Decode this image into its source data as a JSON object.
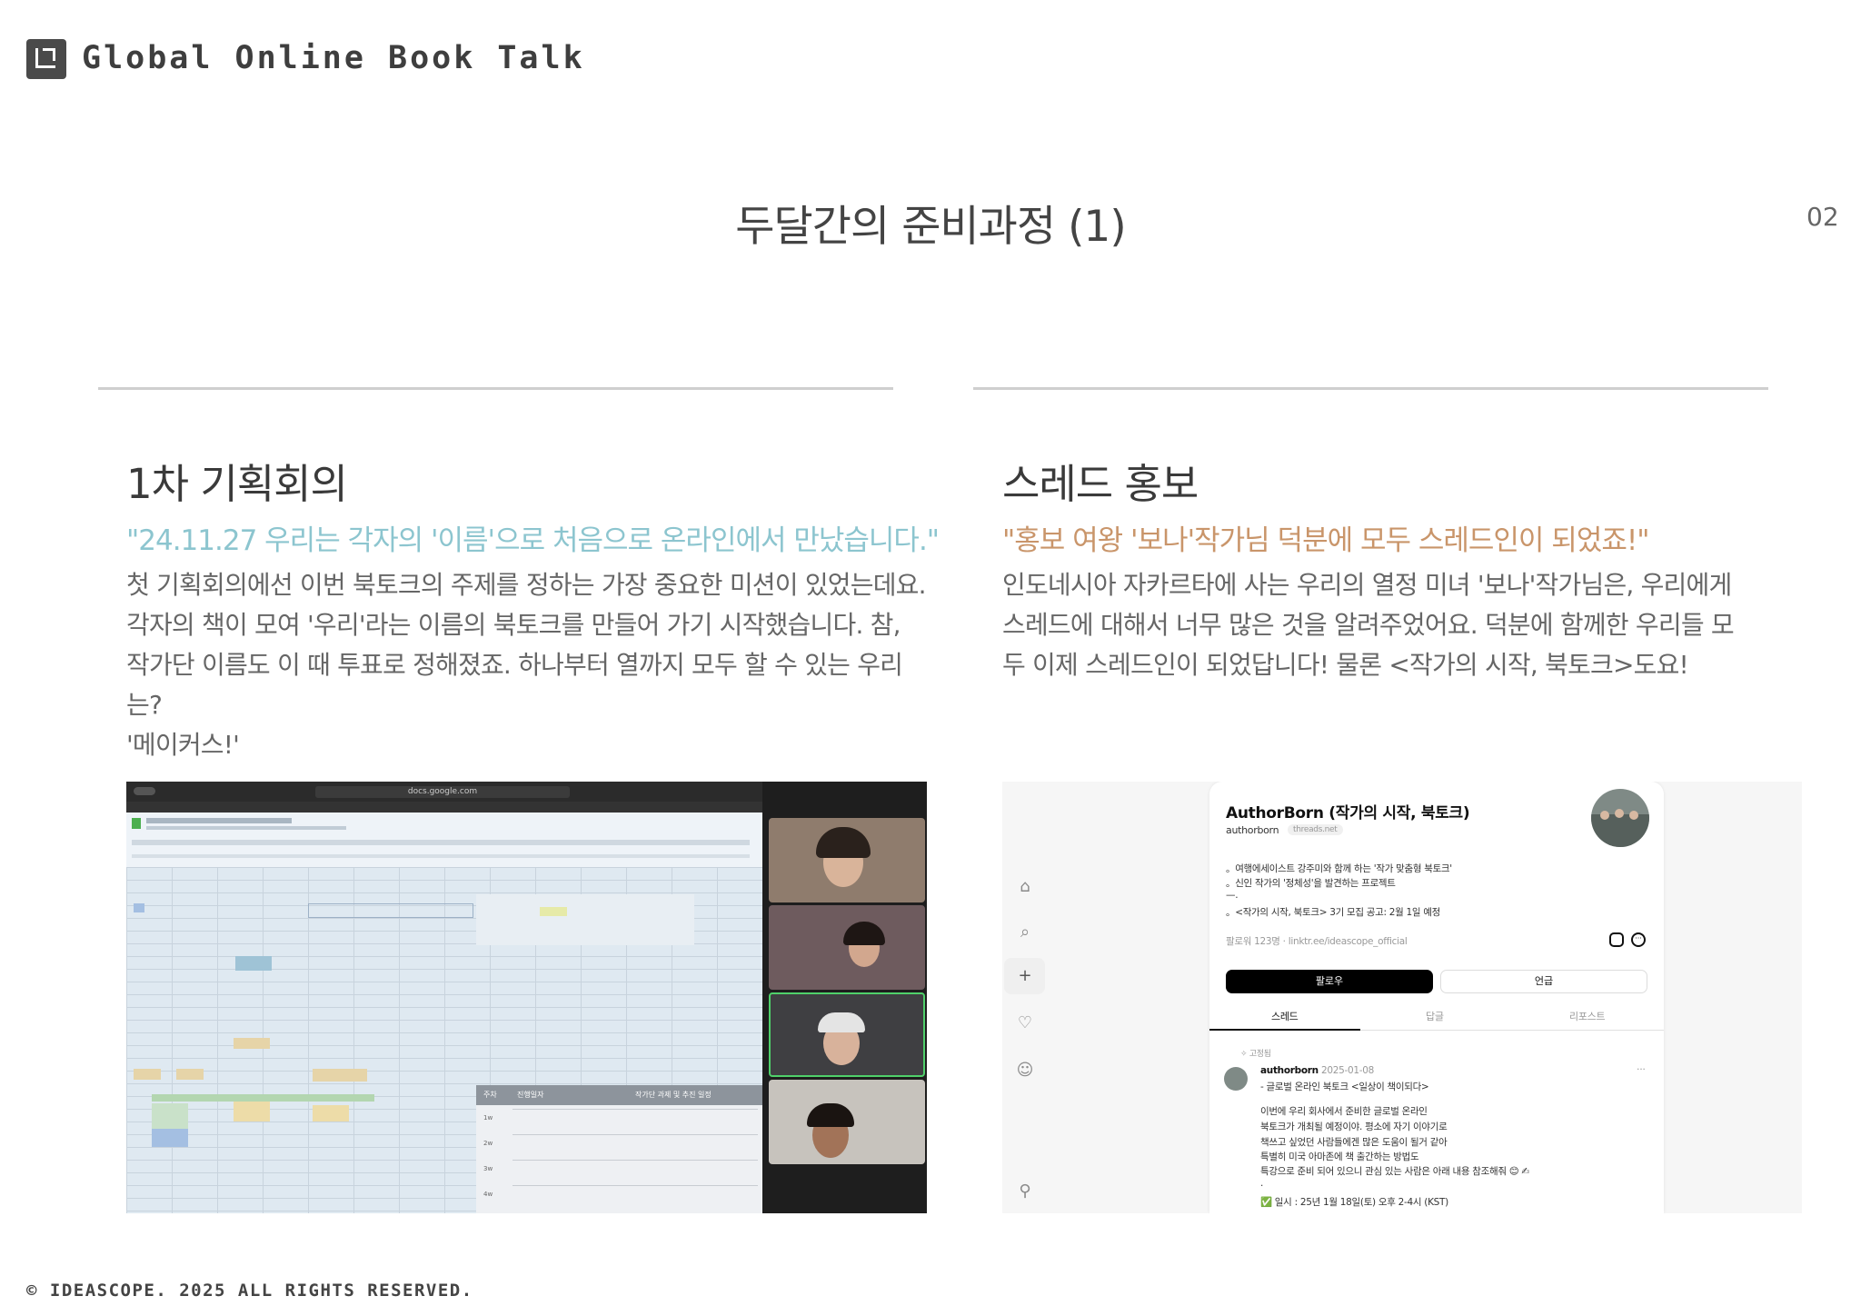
{
  "header": {
    "brand": "Global Online Book Talk",
    "page_number": "02"
  },
  "title": "두달간의 준비과정 (1)",
  "left": {
    "heading": "1차 기획회의",
    "quote": "\"24.11.27 우리는 각자의 '이름'으로 처음으로 온라인에서 만났습니다.\"",
    "body": "첫 기획회의에선 이번 북토크의 주제를 정하는 가장 중요한 미션이 있었는데요.\n각자의 책이 모여  '우리'라는 이름의 북토크를 만들어 가기 시작했습니다. 참,\n작가단 이름도 이 때 투표로 정해졌죠. 하나부터 열까지 모두 할 수 있는 우리는?\n'메이커스!'",
    "screenshot": {
      "url": "docs.google.com",
      "table_header": [
        "주차",
        "진행일자",
        "작가단 과제 및 추진 일정"
      ],
      "table_weeks": [
        "1w",
        "2w",
        "3w",
        "4w"
      ]
    }
  },
  "right": {
    "heading": "스레드 홍보",
    "quote": "\"홍보 여왕 '보나'작가님 덕분에 모두 스레드인이 되었죠!\"",
    "body": "인도네시아 자카르타에 사는 우리의 열정 미녀 '보나'작가님은, 우리에게\n스레드에 대해서 너무 많은 것을 알려주었어요. 덕분에 함께한 우리들 모\n두 이제 스레드인이 되었답니다! 물론 <작가의 시작, 북토크>도요!",
    "profile": {
      "name": "AuthorBorn (작가의 시작, 북토크)",
      "handle": "authorborn",
      "badge": "threads.net",
      "bio": [
        "。여행에세이스트 강주미와 함께 하는 '작가 맞춤형 북토크'",
        "。신인 작가의 '정체성'을 발견하는 프로젝트",
        "—.",
        "。<작가의 시작, 북토크> 3기 모집 공고: 2월 1일 예정"
      ],
      "followers": "팔로워 123명 · linktr.ee/ideascope_official",
      "follow_button": "팔로우",
      "mention_button": "언급",
      "tabs": [
        "스레드",
        "답글",
        "리포스트"
      ],
      "pinned": "고정됨",
      "post_author": "authorborn",
      "post_date": "2025-01-08",
      "post_more": "···",
      "post_lines": [
        "- 글로벌 온라인 북토크 <일상이 책이되다>",
        "",
        "이번에 우리 회사에서 준비한 글로벌 온라인",
        "북토크가 개최될 예정이야. 평소에 자기 이야기로",
        "책쓰고 싶었던 사람들에겐 많은 도움이 될거 같아",
        "특별히 미국 아마존에 책 출간하는 방법도",
        "특강으로 준비 되어 있으니 관심 있는 사람은 아래 내용 참조해줘 😊 ✍",
        "."
      ],
      "event_line": "✅ 일시 : 25년 1월 18일(토) 오후 2-4시 (KST)"
    }
  },
  "footer": "© IDEASCOPE. 2025 ALL RIGHTS RESERVED.",
  "colors": {
    "left_quote": "#8cc5cf",
    "right_quote": "#c9956a",
    "rule": "#cfcfcf",
    "logo": "#4a4a4a"
  }
}
